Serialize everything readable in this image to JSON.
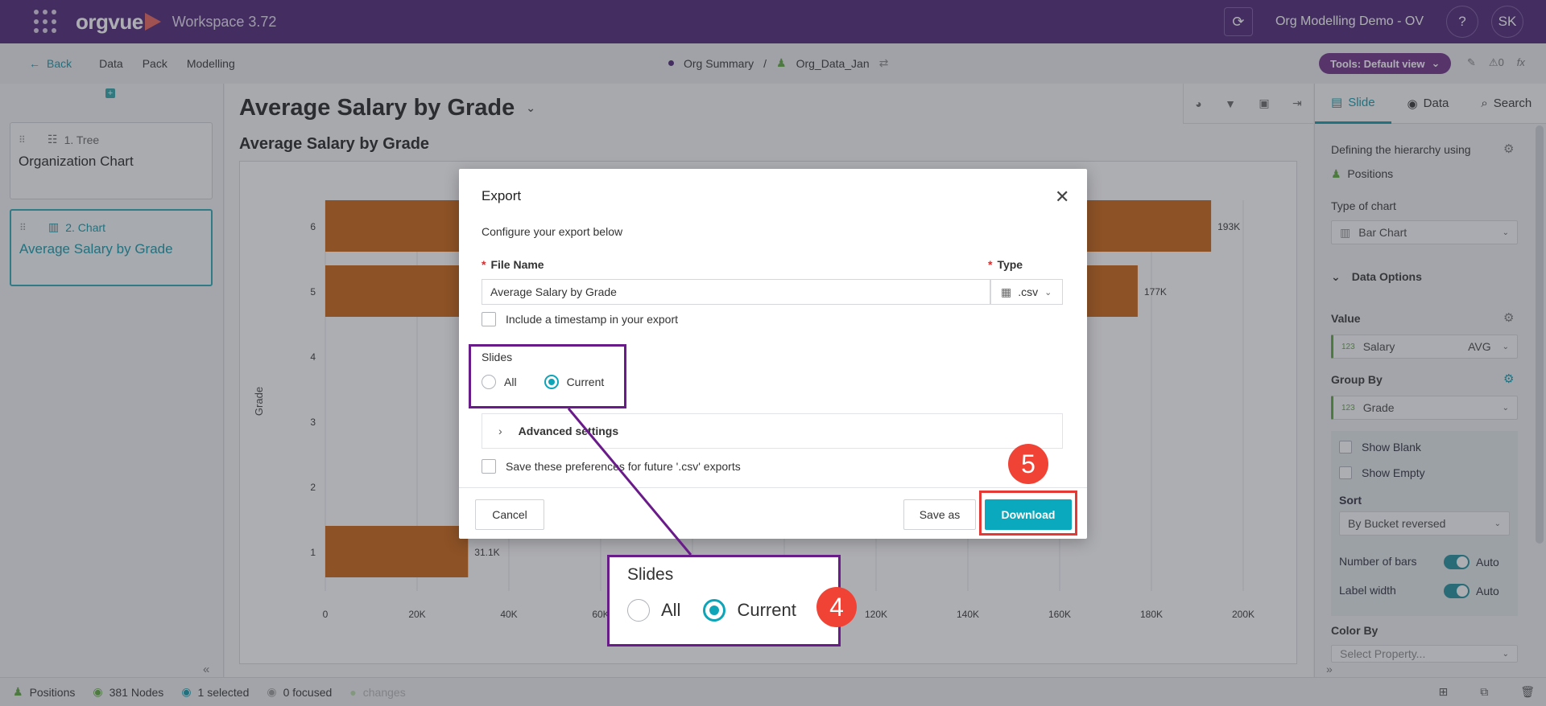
{
  "topbar": {
    "logo": "orgvue",
    "workspace": "Workspace  3.72",
    "project": "Org Modelling Demo - OV",
    "help": "?",
    "avatar": "SK"
  },
  "subnav": {
    "back": "Back",
    "links": [
      "Data",
      "Pack",
      "Modelling"
    ],
    "breadcrumb": [
      "Org Summary",
      "/",
      "Org_Data_Jan"
    ],
    "tools": "Tools: Default view",
    "counter": "0",
    "fx": "fx"
  },
  "sidebar": {
    "cards": [
      {
        "type": "1. Tree",
        "name": "Organization Chart"
      },
      {
        "type": "2. Chart",
        "name": "Average Salary by Grade"
      }
    ]
  },
  "main": {
    "title": "Average Salary by Grade",
    "chart_title": "Average Salary by Grade"
  },
  "chart_data": {
    "type": "bar",
    "orientation": "horizontal",
    "categories": [
      "6",
      "5",
      "4",
      "3",
      "2",
      "1"
    ],
    "values": [
      193000,
      177000,
      0,
      0,
      0,
      31100
    ],
    "value_labels": [
      "193K",
      "177K",
      "",
      "",
      "",
      "31.1K"
    ],
    "title": "Average Salary by Grade",
    "ylabel": "Grade",
    "xlim": [
      0,
      200000
    ],
    "x_ticks": [
      "0",
      "20K",
      "40K",
      "60K",
      "80K",
      "100K",
      "120K",
      "140K",
      "160K",
      "180K",
      "200K"
    ],
    "bar_color": "#c8610f",
    "grid": true
  },
  "rightpanel": {
    "tabs": [
      "Slide",
      "Data",
      "Search"
    ],
    "hierarchy_label": "Defining the hierarchy using",
    "hierarchy_value": "Positions",
    "chart_type_label": "Type of chart",
    "chart_type_value": "Bar Chart",
    "data_options": "Data Options",
    "value_label": "Value",
    "value_field": "Salary",
    "value_agg": "AVG",
    "value_badge": "123",
    "groupby_label": "Group By",
    "groupby_field": "Grade",
    "groupby_badge": "123",
    "show_blank": "Show Blank",
    "show_empty": "Show Empty",
    "sort_label": "Sort",
    "sort_value": "By Bucket reversed",
    "num_bars": "Number of bars",
    "label_width": "Label width",
    "auto": "Auto",
    "color_by": "Color By",
    "color_by_placeholder": "Select Property..."
  },
  "bottombar": {
    "positions": "Positions",
    "nodes": "381 Nodes",
    "selected": "1 selected",
    "focused": "0 focused",
    "changes": "changes"
  },
  "dialog": {
    "title": "Export",
    "subtitle": "Configure your export below",
    "file_name_label": "File Name",
    "type_label": "Type",
    "file_name_value": "Average Salary by Grade",
    "type_value": ".csv",
    "timestamp": "Include a timestamp in your export",
    "slides_label": "Slides",
    "slides_all": "All",
    "slides_current": "Current",
    "advanced": "Advanced settings",
    "save_prefs": "Save these preferences for future '.csv' exports",
    "cancel": "Cancel",
    "save_as": "Save as",
    "download": "Download"
  },
  "annotations": {
    "zoom_title": "Slides",
    "zoom_all": "All",
    "zoom_current": "Current",
    "badge4": "4",
    "badge5": "5"
  }
}
